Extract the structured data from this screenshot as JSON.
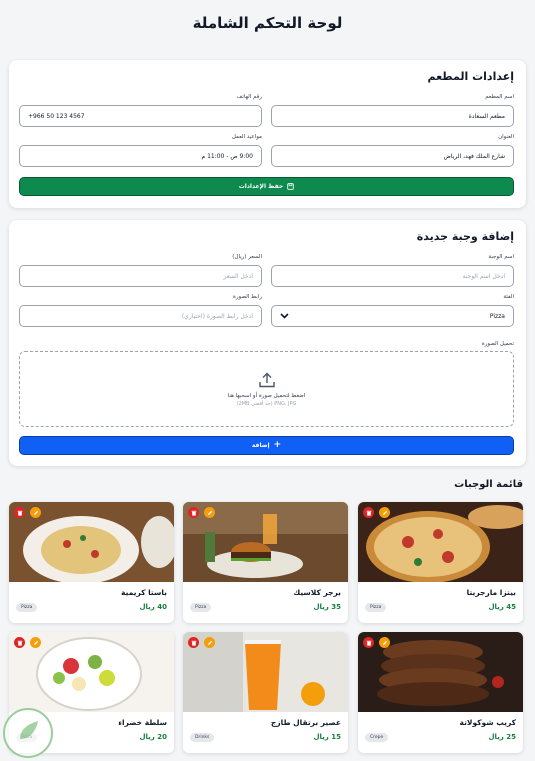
{
  "page": {
    "title": "لوحة التحكم الشاملة"
  },
  "settings": {
    "title": "إعدادات المطعم",
    "name_label": "اسم المطعم",
    "name_value": "مطعم السعادة",
    "phone_label": "رقم الهاتف",
    "phone_value": "+966 50 123 4567",
    "address_label": "العنوان",
    "address_value": "شارع الملك فهد، الرياض",
    "hours_label": "مواعيد العمل",
    "hours_value": "9:00 ص - 11:00 م",
    "save_label": "حفظ الإعدادات"
  },
  "add_meal": {
    "title": "إضافة وجبة جديدة",
    "name_label": "اسم الوجبة",
    "name_placeholder": "أدخل اسم الوجبة",
    "price_label": "السعر (ريال)",
    "price_placeholder": "أدخل السعر",
    "category_label": "الفئة",
    "category_value": "Pizza",
    "image_url_label": "رابط الصورة",
    "image_url_placeholder": "أدخل رابط الصورة (اختياري)",
    "upload_label": "تحميل الصورة",
    "upload_main": "اضغط لتحميل صورة أو اسحبها هنا",
    "upload_hint": "PNG, JPG (حد أقصى 2MB)",
    "add_label": "إضافة"
  },
  "meals_section": {
    "title": "قائمة الوجبات"
  },
  "meals": [
    {
      "name": "بيتزا مارجريتا",
      "price": "45 ريال",
      "category": "Pizza"
    },
    {
      "name": "برجر كلاسيك",
      "price": "35 ريال",
      "category": "Pizza"
    },
    {
      "name": "باستا كريمية",
      "price": "40 ريال",
      "category": "Pizza"
    },
    {
      "name": "كريب شوكولاتة",
      "price": "25 ريال",
      "category": "Crepe"
    },
    {
      "name": "عصير برتقال طازج",
      "price": "15 ريال",
      "category": "Drinks"
    },
    {
      "name": "سلطة خضراء",
      "price": "20 ريال",
      "category": "Pizza"
    }
  ],
  "colors": {
    "save_button": "#0f8a4f",
    "add_button": "#1060f5",
    "price_text": "#16803c",
    "delete_icon": "#dc2626",
    "edit_icon": "#f59e0b"
  },
  "icons": [
    "save-icon",
    "upload-icon",
    "plus-icon",
    "chevron-down-icon",
    "trash-icon",
    "pencil-icon"
  ]
}
